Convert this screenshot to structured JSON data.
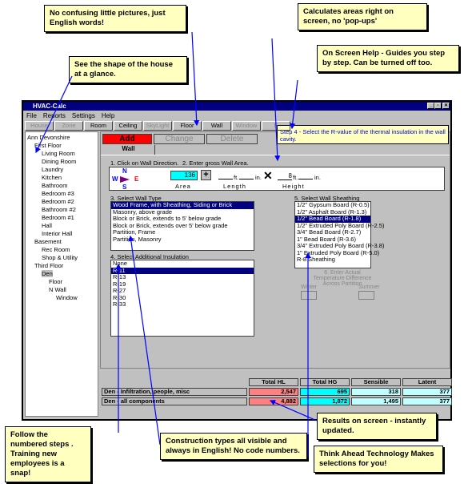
{
  "window": {
    "title": "HVAC-Calc",
    "controls": [
      "_",
      "▫",
      "✕"
    ]
  },
  "menu": [
    "File",
    "Reports",
    "Settings",
    "Help"
  ],
  "toolbar": [
    {
      "label": "House",
      "enabled": false
    },
    {
      "label": "Zone",
      "enabled": false
    },
    {
      "label": "Room",
      "enabled": true
    },
    {
      "label": "Ceiling",
      "enabled": true
    },
    {
      "label": "SkyLight",
      "enabled": false
    },
    {
      "label": "Floor",
      "enabled": true
    },
    {
      "label": "Wall",
      "enabled": true
    },
    {
      "label": "Window",
      "enabled": false
    },
    {
      "label": "E",
      "enabled": false
    }
  ],
  "tree": [
    {
      "label": "Ann Devonshire",
      "level": 0
    },
    {
      "label": "First Floor",
      "level": 1
    },
    {
      "label": "Living Room",
      "level": 2
    },
    {
      "label": "Dining Room",
      "level": 2
    },
    {
      "label": "Laundry",
      "level": 2
    },
    {
      "label": "Kitchen",
      "level": 2
    },
    {
      "label": "Bathroom",
      "level": 2
    },
    {
      "label": "Bedroom #3",
      "level": 2
    },
    {
      "label": "Bedroom #2",
      "level": 2
    },
    {
      "label": "Bathroom #2",
      "level": 2
    },
    {
      "label": "Bedroom #1",
      "level": 2
    },
    {
      "label": "Hall",
      "level": 2
    },
    {
      "label": "Interior Hall",
      "level": 2
    },
    {
      "label": "Basement",
      "level": 1
    },
    {
      "label": "Rec Room",
      "level": 2
    },
    {
      "label": "Shop & Utility",
      "level": 2
    },
    {
      "label": "Third Floor",
      "level": 1
    },
    {
      "label": "Den",
      "level": 2
    },
    {
      "label": "Floor",
      "level": 3
    },
    {
      "label": "N Wall",
      "level": 3
    },
    {
      "label": "Window",
      "level": 4
    }
  ],
  "actions": {
    "add": "Add",
    "change": "Change",
    "delete": "Delete",
    "add_color": "#ff0000"
  },
  "tab": "Wall",
  "tooltip": "Step 4 - Select the R-value of the thermal insulation in the wall cavity.",
  "step1": {
    "label": "1. Click on Wall Direction.",
    "N": "N",
    "S": "S",
    "E": "E",
    "W": "W"
  },
  "step2": {
    "label": "2. Enter gross Wall Area.",
    "area": "136",
    "area_label": "Area",
    "plus": "+",
    "length_label": "Length",
    "height_label": "Height",
    "ft": "ft.",
    "in": "in.",
    "times": "✕",
    "height_ft": "8",
    "length_ft": "",
    "length_in": "",
    "height_in": ""
  },
  "step3": {
    "label": "3. Select Wall Type",
    "items": [
      "Wood Frame, with Sheathing, Siding or Brick",
      "Masonry, above grade",
      "Block or Brick, extends to 5' below grade",
      "Block or Brick, extends over 5' below grade",
      "Partition, Frame",
      "Partition, Masonry"
    ],
    "selected": 0
  },
  "step4": {
    "label": "4. Select Additional Insulation",
    "items": [
      "None",
      "R-11",
      "R-13",
      "R-19",
      "R-27",
      "R-30",
      "R-33"
    ],
    "selected": 1
  },
  "step5": {
    "label": "5. Select Wall Sheathing",
    "items": [
      "1/2\" Gypsum Board (R-0.5)",
      "1/2\" Asphalt Board (R-1.3)",
      "1/2\" Bead Board (R-1.8)",
      "1/2\" Extruded Poly Board (R-2.5)",
      "3/4\" Bead Board (R-2.7)",
      "1\" Bead Board (R-3.6)",
      "3/4\" Extruded Poly Board (R-3.8)",
      "1\" Extruded Poly Board (R-5.0)",
      "R-8 Sheathing"
    ],
    "selected": 2
  },
  "step6": {
    "label": "6. Enter Actual Temperature Difference Across Partition",
    "winter": "Winter",
    "summer": "Summer"
  },
  "results": {
    "headers": [
      "Total HL",
      "Total HG",
      "Sensible",
      "Latent"
    ],
    "rows": [
      {
        "name": "Den - Infiltration, people, misc",
        "values": [
          "2,547",
          "695",
          "318",
          "377"
        ]
      },
      {
        "name": "Den - all components",
        "values": [
          "4,882",
          "1,872",
          "1,495",
          "377"
        ]
      }
    ],
    "colors": {
      "hl": "#ff8080",
      "hg": "#00ffff",
      "other": "#c0ffff"
    }
  },
  "callouts": {
    "words": "No confusing little pictures, just English words!",
    "shape": "See the shape of the house at a glance.",
    "areas": "Calculates areas right on screen, no 'pop-ups'",
    "help": "On Screen Help - Guides you step by step.  Can be turned off too.",
    "steps": "Follow the numbered steps . Training new employees is a snap!",
    "construction": "Construction types all visible and always in English! No code numbers.",
    "results": "Results on screen - instantly updated.",
    "think": "Think Ahead Technology Makes selections for you!"
  }
}
